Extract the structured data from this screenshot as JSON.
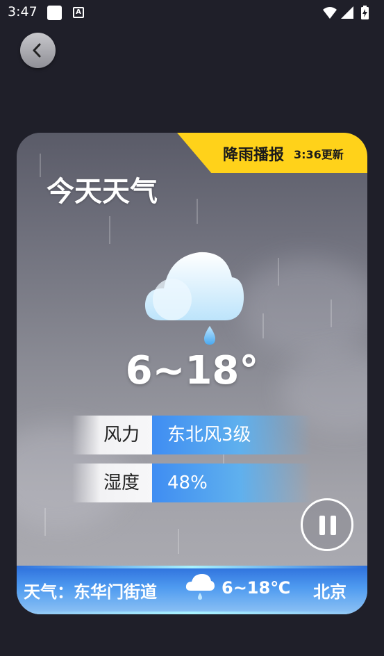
{
  "status_bar": {
    "time": "3:47",
    "notification_icons": [
      "square-app-icon",
      "a-app-icon"
    ],
    "system_icons": [
      "wifi-icon",
      "signal-icon",
      "battery-icon"
    ]
  },
  "back_button": {
    "icon": "chevron-left-icon"
  },
  "card": {
    "badge": {
      "title": "降雨播报",
      "update_time": "3:36更新",
      "color": "#ffd21a"
    },
    "title": "今天天气",
    "weather_icon": "cloud-rain-icon",
    "temperature": "6~18°",
    "rows": [
      {
        "label": "风力",
        "value": "东北风3级"
      },
      {
        "label": "湿度",
        "value": "48%"
      }
    ],
    "pause_icon": "pause-icon",
    "ticker": {
      "prefix": "天气：东华门街道",
      "icon": "cloud-rain-icon",
      "temperature": "6~18℃",
      "next": "北京"
    }
  },
  "colors": {
    "background": "#1f1f29",
    "badge": "#ffd21a",
    "accent_blue": "#3f8df2"
  }
}
